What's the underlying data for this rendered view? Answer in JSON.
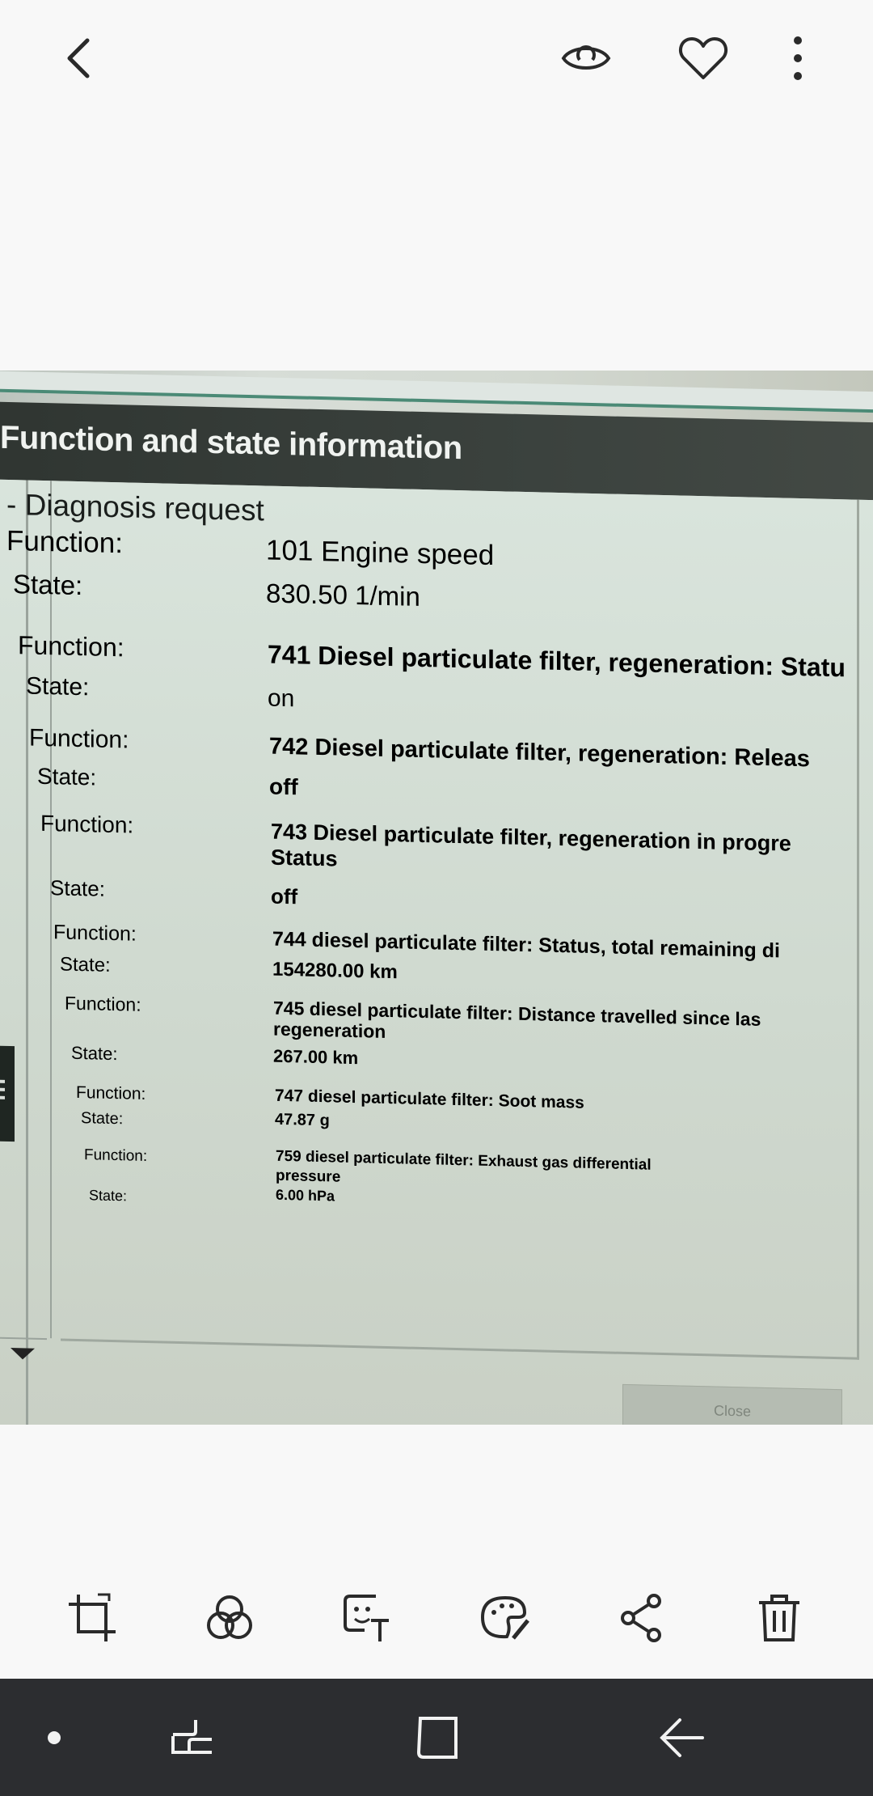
{
  "toolbar": {
    "back_icon": "chevron-left-icon",
    "view_icon": "eye-icon",
    "favorite_icon": "heart-icon",
    "more_icon": "more-vertical-icon"
  },
  "photo": {
    "window_title": "Function and state information",
    "section_title": "- Diagnosis request",
    "function_label": "Function:",
    "state_label": "State:",
    "entries": [
      {
        "function": "101 Engine speed",
        "state": "830.50  1/min"
      },
      {
        "function": "741 Diesel particulate filter, regeneration: Statu",
        "state": "on"
      },
      {
        "function": "742 Diesel particulate filter, regeneration: Releas",
        "state": "off"
      },
      {
        "function": "743 Diesel particulate filter, regeneration in progre",
        "function_line2": "Status",
        "state": "off"
      },
      {
        "function": "744 diesel particulate filter: Status, total remaining di",
        "state": "154280.00  km"
      },
      {
        "function": "745 diesel particulate filter: Distance travelled since las",
        "function_line2": "regeneration",
        "state": "267.00  km"
      },
      {
        "function": "747 diesel particulate filter: Soot mass",
        "state": "47.87  g"
      },
      {
        "function": "759 diesel particulate filter: Exhaust gas differential",
        "function_line2": "pressure",
        "state": "6.00  hPa"
      }
    ],
    "close_button": "Close"
  },
  "bottom_tools": [
    "crop-icon",
    "filter-icon",
    "sticker-text-icon",
    "palette-brush-icon",
    "share-icon",
    "trash-icon"
  ],
  "navbar": [
    "dot-icon",
    "recent-apps-icon",
    "home-icon",
    "back-icon"
  ],
  "colors": {
    "background": "#f8f8f8",
    "navbar": "#2c2d30",
    "titlebar": "#353b37",
    "screen_bg": "#d4ded6",
    "accent_line": "#4b8a76"
  }
}
